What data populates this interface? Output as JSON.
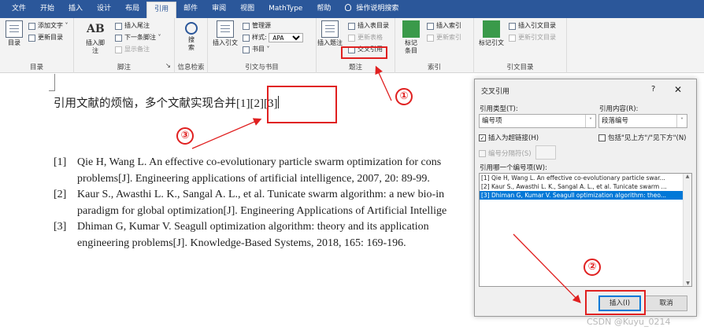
{
  "tabs": [
    "文件",
    "开始",
    "插入",
    "设计",
    "布局",
    "引用",
    "邮件",
    "审阅",
    "视图",
    "MathType",
    "帮助"
  ],
  "active_tab": "引用",
  "tell_me": "操作说明搜索",
  "ribbon": {
    "toc": {
      "big": "目录",
      "add_text": "添加文字",
      "update": "更新目录",
      "group": "目录"
    },
    "footnotes": {
      "insert_footnote": "插入脚注",
      "insert_endnote": "插入尾注",
      "next_footnote": "下一条脚注",
      "show_notes": "显示备注",
      "group": "脚注",
      "ab_glyph": "AB"
    },
    "research": {
      "search_line1": "搜",
      "search_line2": "索",
      "group": "信息检索"
    },
    "citations": {
      "insert_citation": "插入引文",
      "manage_sources": "管理源",
      "style_label": "样式:",
      "style_value": "APA",
      "bibliography": "书目",
      "group": "引文与书目"
    },
    "captions": {
      "insert_caption": "插入题注",
      "insert_table_of_figures": "插入表目录",
      "update_table": "更新表格",
      "cross_reference": "交叉引用",
      "group": "题注"
    },
    "index": {
      "mark_entry_line1": "标记",
      "mark_entry_line2": "条目",
      "insert_index": "插入索引",
      "update_index": "更新索引",
      "group": "索引"
    },
    "toa": {
      "mark_citation": "标记引文",
      "insert_toa": "插入引文目录",
      "update_toa": "更新引文目录",
      "group": "引文目录"
    }
  },
  "document": {
    "main_text": "引用文献的烦恼，多个文献实现合并",
    "citation": "[1][2][3]",
    "references": [
      {
        "num": "[1]",
        "line1": "Qie H, Wang L. An effective co-evolutionary particle swarm optimization for cons",
        "line2": "problems[J]. Engineering applications of artificial intelligence, 2007, 20: 89-99."
      },
      {
        "num": "[2]",
        "line1": "Kaur S., Awasthi L. K., Sangal A. L., et al. Tunicate swarm algorithm: a new bio-in",
        "line2": "paradigm for global optimization[J]. Engineering Applications of Artificial Intellige"
      },
      {
        "num": "[3]",
        "line1": "Dhiman G, Kumar V. Seagull optimization algorithm: theory and its application",
        "line2": "engineering problems[J]. Knowledge-Based Systems, 2018, 165: 169-196."
      }
    ]
  },
  "dialog": {
    "title": "交叉引用",
    "help": "?",
    "close": "✕",
    "ref_type_label": "引用类型(T):",
    "ref_type_value": "编号项",
    "ref_content_label": "引用内容(R):",
    "ref_content_value": "段落编号",
    "insert_hyperlink": "插入为超链接(H)",
    "include_above_below": "包括\"见上方\"/\"见下方\"(N)",
    "separate_numbers": "编号分隔符(S)",
    "which_item_label": "引用哪一个编号项(W):",
    "items": [
      "[1] Qie H, Wang L. An effective co-evolutionary particle swar...",
      "[2] Kaur S., Awasthi L. K., Sangal A. L., et al. Tunicate swarm ...",
      "[3] Dhiman G, Kumar V. Seagull optimization algorithm: theo..."
    ],
    "selected_index": 2,
    "insert_button": "插入(I)",
    "cancel_button": "取消"
  },
  "annotations": {
    "one": "①",
    "two": "②",
    "three": "③"
  },
  "watermark": "CSDN @Kuyu_0214",
  "colors": {
    "tab_bar": "#2b579a",
    "annotation_red": "#e02020",
    "selection_blue": "#0078d7"
  }
}
